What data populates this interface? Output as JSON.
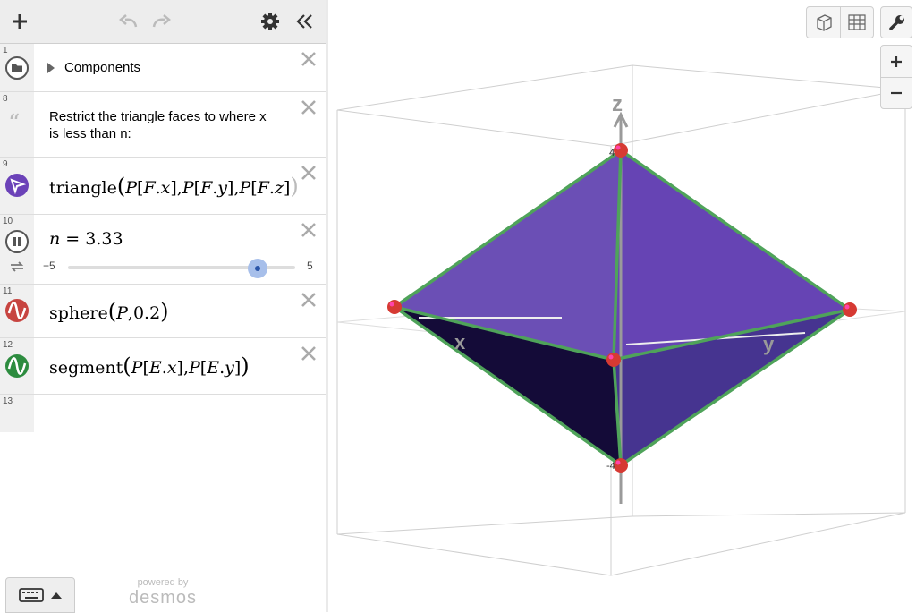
{
  "toolbar": {
    "add_icon": "plus-icon",
    "undo_icon": "undo-icon",
    "redo_icon": "redo-icon",
    "settings_icon": "gear-icon",
    "collapse_icon": "double-chevron-left-icon"
  },
  "expressions": [
    {
      "line": "1",
      "type": "folder",
      "label": "Components"
    },
    {
      "line": "8",
      "type": "note",
      "text_line1": "Restrict the triangle faces to where x",
      "text_line2": "is less than n:"
    },
    {
      "line": "9",
      "type": "triangle",
      "func": "triangle",
      "color": "#6b42b8"
    },
    {
      "line": "10",
      "type": "slider",
      "var": "n",
      "eq": "=",
      "value": "3.33",
      "min": "−5",
      "max": "5",
      "fraction": 0.833
    },
    {
      "line": "11",
      "type": "sphere",
      "func": "sphere",
      "arg2": "0.2",
      "color": "#c74440"
    },
    {
      "line": "12",
      "type": "segment",
      "func": "segment",
      "color": "#2d8c3f"
    },
    {
      "line": "13",
      "type": "empty"
    }
  ],
  "footer": {
    "powered_by": "powered by",
    "brand": "desmos"
  },
  "graph": {
    "axis_x": "x",
    "axis_y": "y",
    "axis_z": "z",
    "tick_z_top": "4",
    "tick_z_bottom": "-4",
    "face_color": "#6b4fb5",
    "edge_color": "#4fa35a",
    "point_color": "#d63a33"
  }
}
